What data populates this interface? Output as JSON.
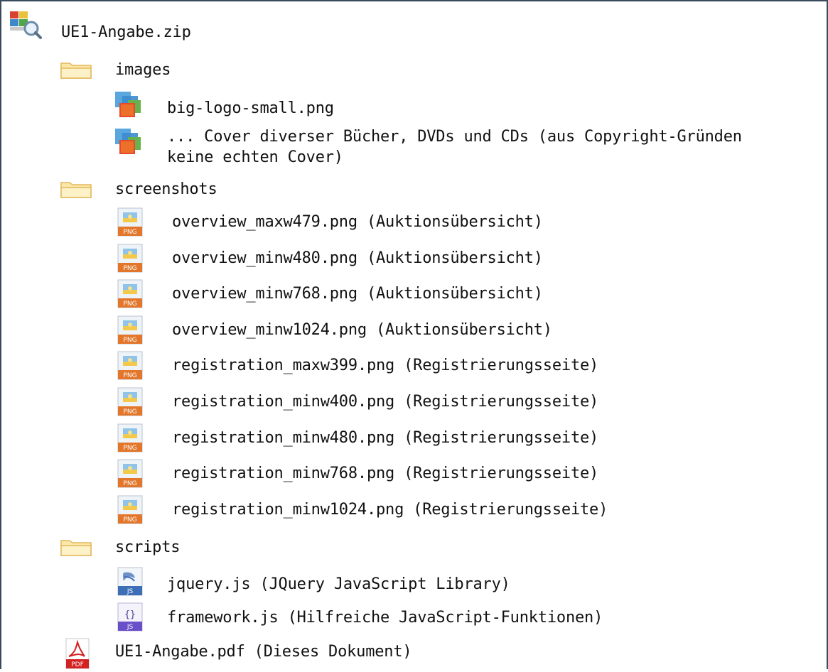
{
  "archive": {
    "name": "UE1-Angabe.zip",
    "icon": "zip-archive-icon"
  },
  "tree": {
    "images_folder": {
      "name": "images",
      "icon": "folder-icon",
      "files": [
        {
          "line1": "big-logo-small.png",
          "icon": "image-file-icon"
        },
        {
          "line1": "... Cover diverser Bücher, DVDs und CDs (aus Copyright-Gründen",
          "line2": "keine echten Cover)",
          "icon": "image-file-icon"
        }
      ]
    },
    "screenshots_folder": {
      "name": "screenshots",
      "icon": "folder-icon",
      "files": [
        {
          "label": "overview_maxw479.png (Auktionsübersicht)",
          "icon": "png-file-icon"
        },
        {
          "label": "overview_minw480.png (Auktionsübersicht)",
          "icon": "png-file-icon"
        },
        {
          "label": "overview_minw768.png (Auktionsübersicht)",
          "icon": "png-file-icon"
        },
        {
          "label": "overview_minw1024.png (Auktionsübersicht)",
          "icon": "png-file-icon"
        },
        {
          "label": "registration_maxw399.png (Registrierungsseite)",
          "icon": "png-file-icon"
        },
        {
          "label": "registration_minw400.png (Registrierungsseite)",
          "icon": "png-file-icon"
        },
        {
          "label": "registration_minw480.png (Registrierungsseite)",
          "icon": "png-file-icon"
        },
        {
          "label": "registration_minw768.png (Registrierungsseite)",
          "icon": "png-file-icon"
        },
        {
          "label": "registration_minw1024.png (Registrierungsseite)",
          "icon": "png-file-icon"
        }
      ]
    },
    "scripts_folder": {
      "name": "scripts",
      "icon": "folder-icon",
      "files": [
        {
          "label": "jquery.js (JQuery JavaScript Library)",
          "icon": "jquery-js-file-icon",
          "badge": "JS"
        },
        {
          "label": "framework.js (Hilfreiche JavaScript-Funktionen)",
          "icon": "js-file-icon",
          "badge": "JS",
          "glyph": "{}"
        }
      ]
    },
    "pdf_file": {
      "label": "UE1-Angabe.pdf (Dieses Dokument)",
      "icon": "pdf-file-icon",
      "badge": "PDF"
    }
  },
  "png_badge": "PNG",
  "colors": {
    "frame_border": "#3a4a5e",
    "text": "#111111",
    "folder_fill": "#fbe7a8",
    "folder_edge": "#e3b75b",
    "png_badge": "#e2762a",
    "js_badge": "#3d6fb6",
    "js2_badge": "#6a50c8",
    "pdf_red": "#d32222"
  }
}
